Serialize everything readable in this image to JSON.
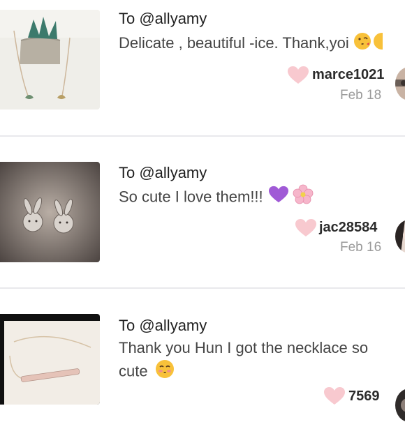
{
  "comments": [
    {
      "to": "To @allyamy",
      "message": "Delicate , beautiful -ice. Thank,yoi",
      "user": "marce1021",
      "date": "Feb 18",
      "emoji": [
        "kiss-face-icon",
        "smile-face-icon"
      ]
    },
    {
      "to": "To @allyamy",
      "message": "So cute I love them!!!",
      "user": "jac28584",
      "date": "Feb 16",
      "emoji": [
        "purple-heart-icon",
        "cherry-blossom-icon"
      ]
    },
    {
      "to": "To @allyamy",
      "message_line1": "Thank you Hun I got the necklace so",
      "message_line2": "cute",
      "user": "7569",
      "emoji": [
        "kissing-face-icon"
      ]
    }
  ],
  "colors": {
    "heart": "#f8c9cf",
    "divider": "#e9e9ec",
    "muted": "#9a9a9a"
  }
}
